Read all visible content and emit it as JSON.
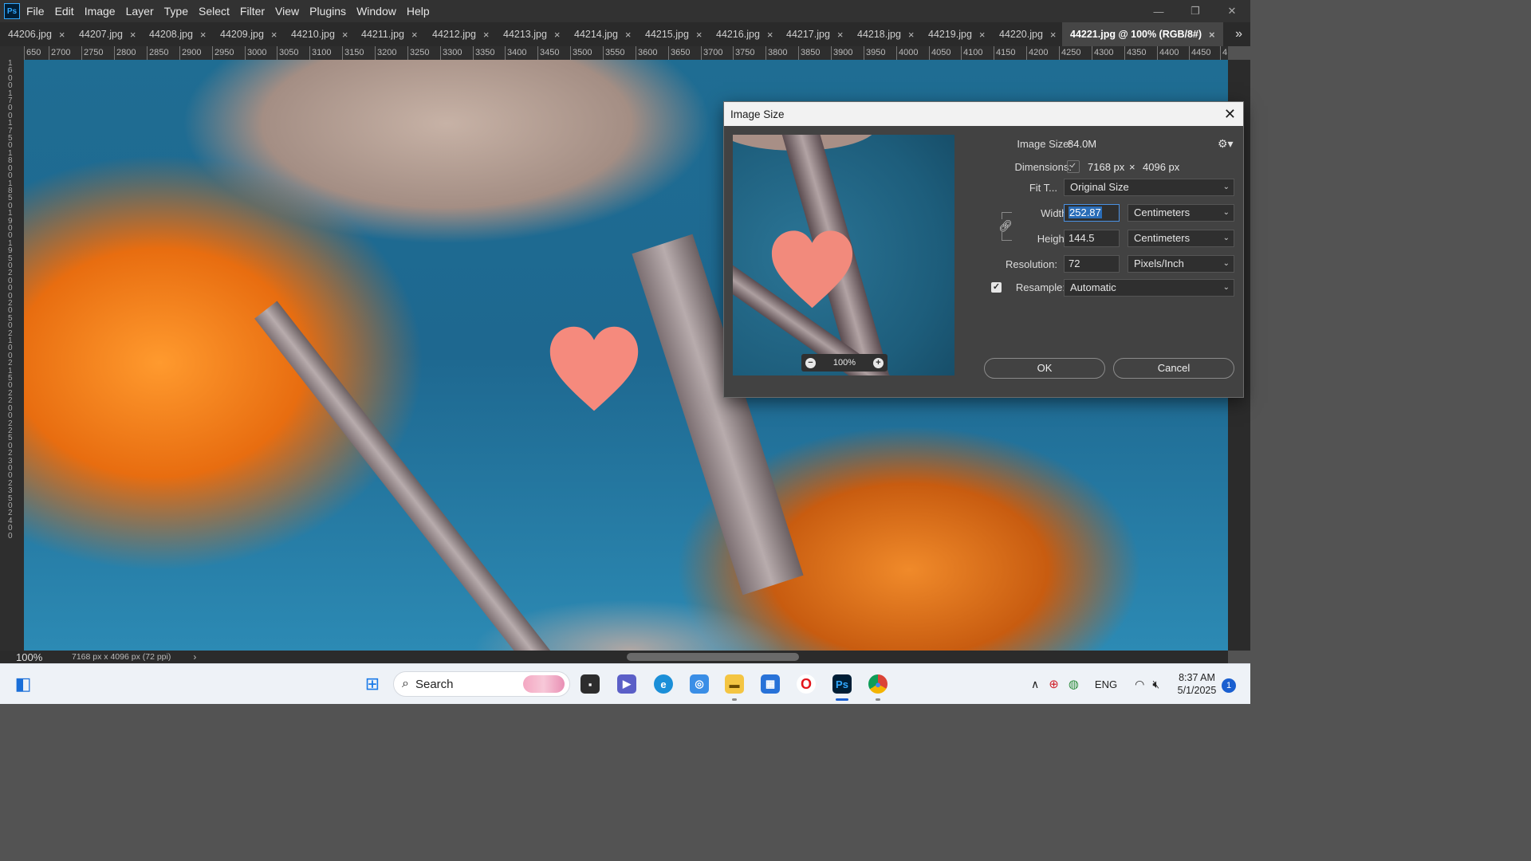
{
  "app": {
    "logo": "Ps",
    "menu": [
      "File",
      "Edit",
      "Image",
      "Layer",
      "Type",
      "Select",
      "Filter",
      "View",
      "Plugins",
      "Window",
      "Help"
    ]
  },
  "tabs": [
    {
      "label": "44206.jpg",
      "active": false
    },
    {
      "label": "44207.jpg",
      "active": false
    },
    {
      "label": "44208.jpg",
      "active": false
    },
    {
      "label": "44209.jpg",
      "active": false
    },
    {
      "label": "44210.jpg",
      "active": false
    },
    {
      "label": "44211.jpg",
      "active": false
    },
    {
      "label": "44212.jpg",
      "active": false
    },
    {
      "label": "44213.jpg",
      "active": false
    },
    {
      "label": "44214.jpg",
      "active": false
    },
    {
      "label": "44215.jpg",
      "active": false
    },
    {
      "label": "44216.jpg",
      "active": false
    },
    {
      "label": "44217.jpg",
      "active": false
    },
    {
      "label": "44218.jpg",
      "active": false
    },
    {
      "label": "44219.jpg",
      "active": false
    },
    {
      "label": "44220.jpg",
      "active": false
    },
    {
      "label": "44221.jpg @ 100% (RGB/8#)",
      "active": true
    }
  ],
  "tab_close": "×",
  "tab_more": "»",
  "ruler_top": [
    "650",
    "2700",
    "2750",
    "2800",
    "2850",
    "2900",
    "2950",
    "3000",
    "3050",
    "3100",
    "3150",
    "3200",
    "3250",
    "3300",
    "3350",
    "3400",
    "3450",
    "3500",
    "3550",
    "3600",
    "3650",
    "3700",
    "3750",
    "3800",
    "3850",
    "3900",
    "3950",
    "4000",
    "4050",
    "4100",
    "4150",
    "4200",
    "4250",
    "4300",
    "4350",
    "4400",
    "4450",
    "4"
  ],
  "ruler_left": "1600170017501800185019001950200020502100215022002250230023502400",
  "status": {
    "zoom": "100%",
    "info": "7168 px x 4096 px (72 ppi)",
    "arrow": "›"
  },
  "dialog": {
    "title": "Image Size",
    "close": "✕",
    "preview_zoom": "100%",
    "image_size_label": "Image Size:",
    "image_size_value": "84.0M",
    "dimensions_label": "Dimensions:",
    "dim_width": "7168 px",
    "dim_times": "×",
    "dim_height": "4096 px",
    "fit_label": "Fit T...",
    "fit_value": "Original Size",
    "width_label": "Width:",
    "width_value": "252.87",
    "width_unit": "Centimeters",
    "height_label": "Height:",
    "height_value": "144.5",
    "height_unit": "Centimeters",
    "resolution_label": "Resolution:",
    "resolution_value": "72",
    "resolution_unit": "Pixels/Inch",
    "resample_label": "Resample:",
    "resample_checked": true,
    "resample_value": "Automatic",
    "ok": "OK",
    "cancel": "Cancel"
  },
  "taskbar": {
    "search_placeholder": "Search",
    "tray_lang": "ENG",
    "time": "8:37 AM",
    "date": "5/1/2025",
    "notifications": "1"
  },
  "colors": {
    "ps_blue": "#31a8ff",
    "selection": "#2a6db8",
    "taskbar": "#eef2f7"
  }
}
